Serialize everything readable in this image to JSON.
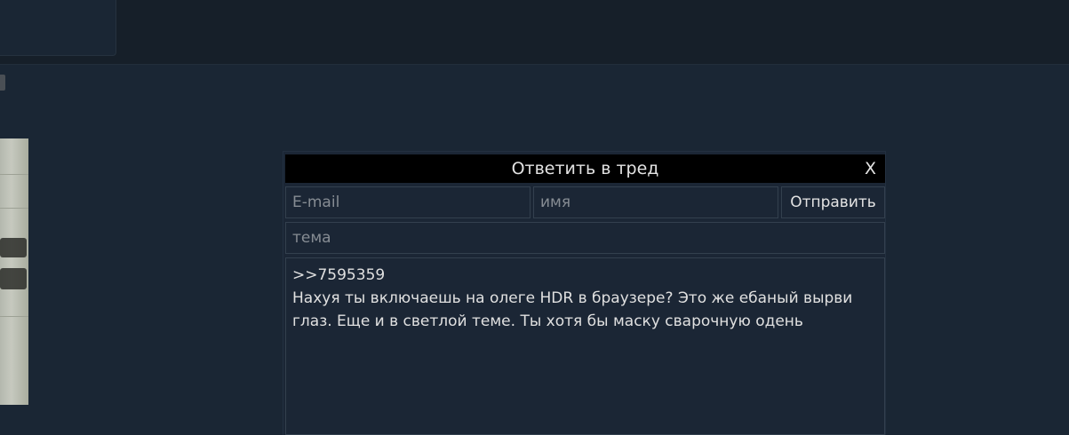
{
  "reply_form": {
    "title": "Ответить в тред",
    "close_label": "X",
    "email_placeholder": "E-mail",
    "name_placeholder": "имя",
    "submit_label": "Отправить",
    "subject_placeholder": "тема",
    "message_text": ">>7595359\nНахуя ты включаешь на олеге HDR в браузере? Это же ебаный вырви глаз. Еще и в светлой теме. Ты хотя бы маску сварочную одень"
  },
  "colors": {
    "page_background": "#1a2634",
    "header_background": "#000000",
    "field_border": "#33404e",
    "text": "#e3e3e3"
  }
}
